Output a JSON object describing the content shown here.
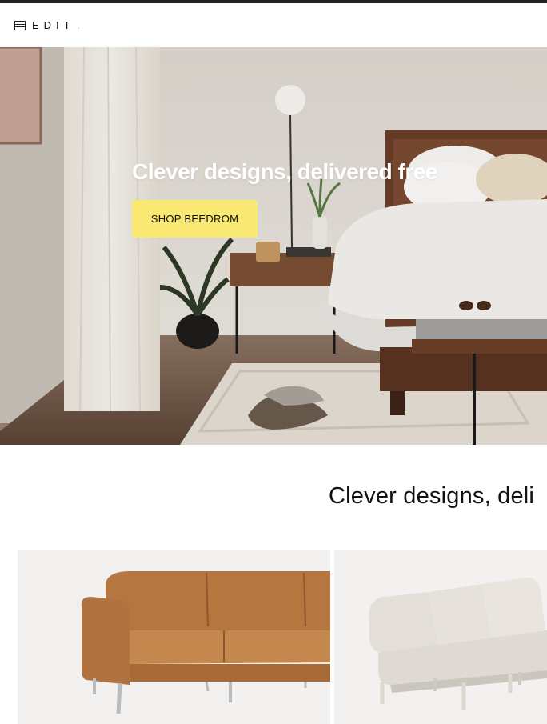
{
  "header": {
    "logo_text": "EDIT",
    "logo_dot": ".",
    "logo_icon": "grid-logo-icon"
  },
  "hero": {
    "title": "Clever designs, delivered free",
    "cta_label": "SHOP BEEDROM",
    "cta_color": "#f9e872"
  },
  "section": {
    "heading": "Clever designs, deli"
  },
  "products": [
    {
      "name": "caramel leather sofa",
      "color": "#b97b48"
    },
    {
      "name": "cream modular sofa",
      "color": "#e6e2db"
    }
  ],
  "colors": {
    "topbar": "#1c2123",
    "text": "#111111",
    "card_background": "#f2f1ef"
  }
}
